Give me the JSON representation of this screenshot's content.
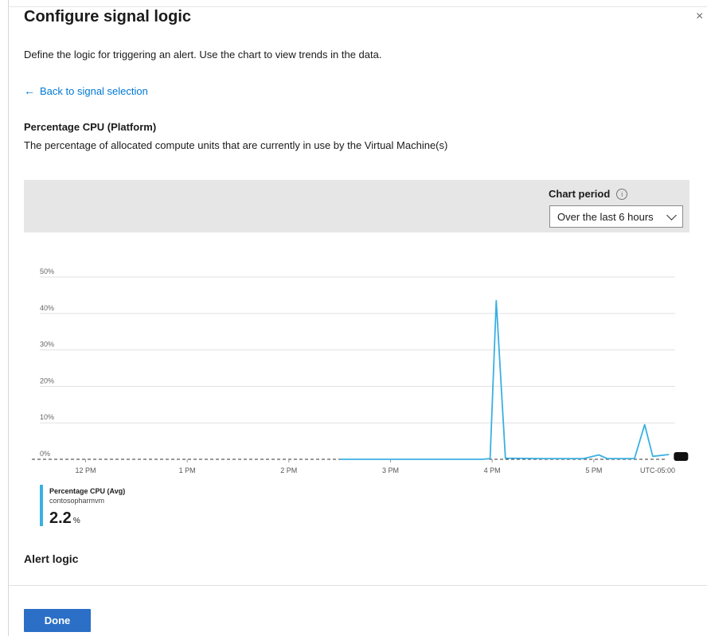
{
  "panel": {
    "title": "Configure signal logic",
    "close_glyph": "×",
    "description": "Define the logic for triggering an alert. Use the chart to view trends in the data.",
    "back_link": {
      "arrow": "←",
      "label": "Back to signal selection"
    }
  },
  "signal": {
    "name": "Percentage CPU (Platform)",
    "description": "The percentage of allocated compute units that are currently in use by the Virtual Machine(s)"
  },
  "chart_controls": {
    "period_label": "Chart period",
    "period_info_icon": "info-icon",
    "period_value": "Over the last 6 hours"
  },
  "chart_data": {
    "type": "line",
    "title": "",
    "xlabel": "",
    "ylabel": "",
    "ylim": [
      0,
      50
    ],
    "y_ticks": [
      "50%",
      "40%",
      "30%",
      "20%",
      "10%",
      "0%"
    ],
    "y_tick_values": [
      50,
      40,
      30,
      20,
      10,
      0
    ],
    "x_ticks": [
      "12 PM",
      "1 PM",
      "2 PM",
      "3 PM",
      "4 PM",
      "5 PM"
    ],
    "x_tick_hours": [
      12,
      13,
      14,
      15,
      16,
      17
    ],
    "x_range_hours": [
      11.55,
      17.8
    ],
    "timezone_label": "UTC-05:00",
    "grid": true,
    "series_color": "#3ab0e2",
    "threshold_line": true,
    "series": [
      {
        "name": "Percentage CPU (Avg)",
        "points": [
          [
            14.5,
            0.0
          ],
          [
            15.9,
            0.0
          ],
          [
            15.98,
            0.2
          ],
          [
            16.04,
            43.5
          ],
          [
            16.13,
            0.3
          ],
          [
            16.5,
            0.2
          ],
          [
            16.9,
            0.2
          ],
          [
            17.05,
            1.2
          ],
          [
            17.13,
            0.2
          ],
          [
            17.4,
            0.2
          ],
          [
            17.5,
            9.5
          ],
          [
            17.58,
            0.8
          ],
          [
            17.74,
            1.3
          ]
        ]
      }
    ]
  },
  "legend": {
    "series_label": "Percentage CPU (Avg)",
    "resource": "contosopharmvm",
    "value": "2.2",
    "unit": "%"
  },
  "alert_logic": {
    "heading": "Alert logic"
  },
  "footer": {
    "done_label": "Done"
  },
  "colors": {
    "accent": "#0078d4",
    "button": "#2b6fc7",
    "series": "#3ab0e2",
    "header_band": "#e6e6e6"
  }
}
